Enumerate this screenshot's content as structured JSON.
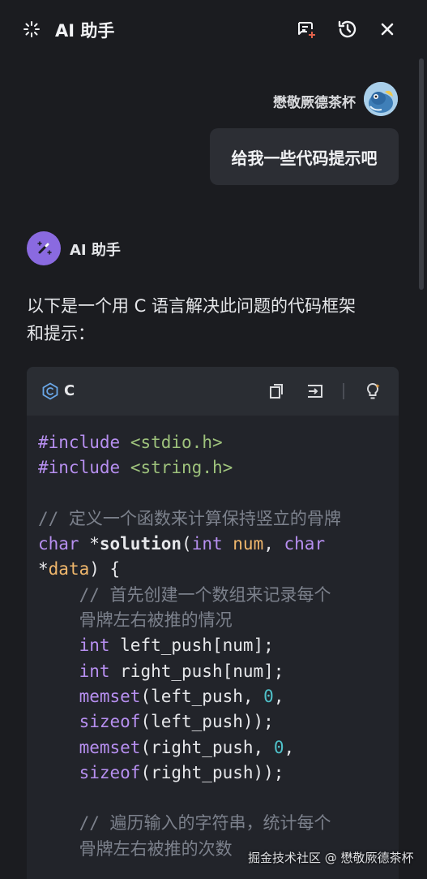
{
  "header": {
    "title": "AI 助手"
  },
  "conversation": {
    "user": {
      "name": "懋敬厥德茶杯",
      "message": "给我一些代码提示吧"
    },
    "assistant": {
      "name": "AI 助手",
      "intro": "以下是一个用 C 语言解决此问题的代码框架和提示："
    }
  },
  "code_block": {
    "language": "C",
    "lines": [
      "#include <stdio.h>",
      "#include <string.h>",
      "",
      "// 定义一个函数来计算保持竖立的骨牌",
      "char *solution(int num, char",
      "*data) {",
      "    // 首先创建一个数组来记录每个",
      "    骨牌左右被推的情况",
      "    int left_push[num];",
      "    int right_push[num];",
      "    memset(left_push, 0,",
      "    sizeof(left_push));",
      "    memset(right_push, 0,",
      "    sizeof(right_push));",
      "",
      "    // 遍历输入的字符串，统计每个",
      "    骨牌左右被推的次数"
    ]
  },
  "watermark": "掘金技术社区 @ 懋敬厥德茶杯",
  "colors": {
    "background": "#1b1c20",
    "bubble": "#2c2e34",
    "code_bg": "#22242a",
    "keyword": "#b78ff0",
    "include_path": "#9ec27c",
    "comment": "#7c818c",
    "number": "#4fc1c9",
    "ai_avatar": "#8a6ae0"
  }
}
